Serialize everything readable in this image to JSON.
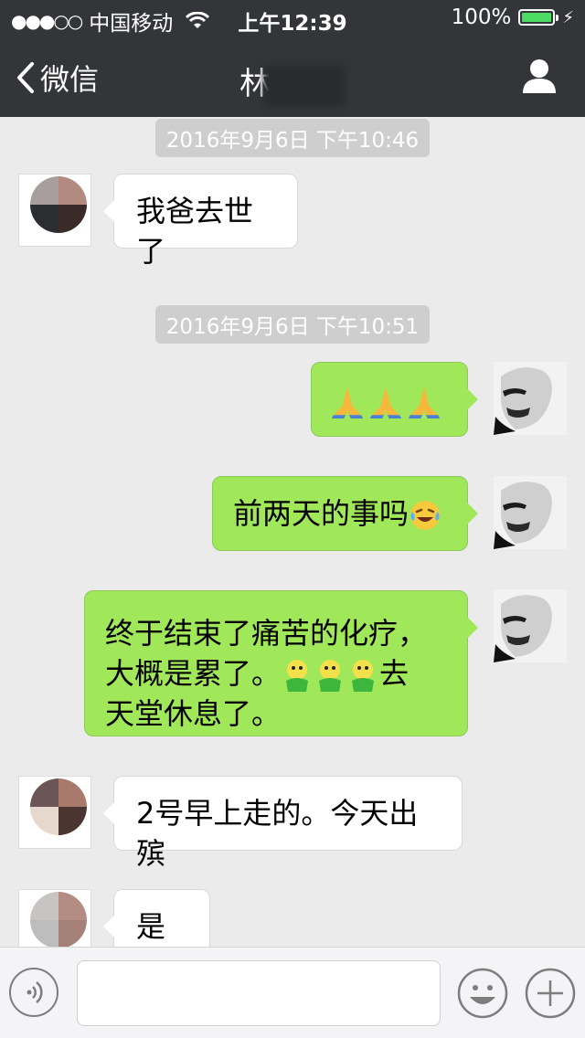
{
  "status_bar": {
    "signal_dots": "●●●○○",
    "carrier": "中国移动",
    "time": "上午12:39",
    "battery_percent": "100%",
    "battery_level": 1.0
  },
  "nav": {
    "back_label": "微信",
    "title_visible": "林"
  },
  "messages": [
    {
      "type": "timestamp",
      "text": "2016年9月6日 下午10:46"
    },
    {
      "type": "in",
      "text": "我爸去世了"
    },
    {
      "type": "timestamp",
      "text": "2016年9月6日 下午10:51"
    },
    {
      "type": "out",
      "emoji": [
        "pray",
        "pray",
        "pray"
      ]
    },
    {
      "type": "out",
      "text": "前两天的事吗",
      "emoji_after": "face-with-tears-of-joy"
    },
    {
      "type": "out",
      "line1": "终于结束了痛苦的化疗，",
      "line2_before": "大概是累了。",
      "line2_after": "去",
      "line3": "天堂休息了。",
      "emoji_inline": [
        "bird",
        "bird",
        "bird"
      ]
    },
    {
      "type": "in",
      "text": "2号早上走的。今天出殡"
    },
    {
      "type": "in",
      "text": "是啊"
    }
  ],
  "colors": {
    "nav_bg": "#333538",
    "chat_bg": "#ebebeb",
    "bubble_out": "#a0e75a",
    "bubble_in": "#ffffff",
    "timestamp_bg": "#cecece",
    "battery_green": "#4cd964"
  },
  "icons": [
    "chevron-left-icon",
    "user-icon",
    "wifi-icon",
    "battery-icon",
    "voice-icon",
    "smiley-icon",
    "plus-icon"
  ]
}
